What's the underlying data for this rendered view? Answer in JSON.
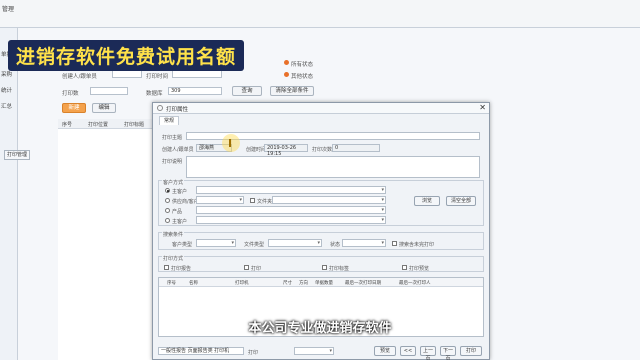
{
  "overlay": {
    "banner_text": "进销存软件免费试用名额",
    "caption_text": "本公司专业做进销存软件"
  },
  "background_app": {
    "menu_label": "管理",
    "nav_items": [
      "单据",
      "采购",
      "统计",
      "汇总"
    ],
    "filter": {
      "row1_label": "创建人/跟单员",
      "row1_field2": "打印时间",
      "radio1": "所有状态",
      "radio2": "其他状态",
      "row2_label": "打印数",
      "row2_field": "数据库",
      "row2_value": "309",
      "query_button": "查询",
      "clear_button": "清除全部条件"
    },
    "toolbar": {
      "new_button": "新建",
      "edit_button": "编辑"
    },
    "grid_columns": [
      "序号",
      "打印位置",
      "打印标题"
    ],
    "side_button": "打印管理"
  },
  "dialog": {
    "title": "打印属性",
    "close_glyph": "✕",
    "tab": "常规",
    "print_title_label": "打印主题",
    "creator_label": "创建人/跟单员",
    "creator_value": "邵海燕",
    "time_label": "创建时间",
    "time_value": "2019-03-26 19:15",
    "print_count_label": "打印次数",
    "print_count_value": "0",
    "remark_label": "打印说明",
    "customer_section": "客户方式",
    "radio_main": "主客户",
    "radio_supplier": "供应商/客户",
    "radio_product": "产品",
    "radio_client": "主客户",
    "file_label": "文件夹",
    "btn_browse": "浏览",
    "btn_clear": "清空全部",
    "cond_section": "搜索条件",
    "cond_customer": "客户类型",
    "cond_file": "文件类型",
    "cond_status": "状态",
    "cond_check": "搜索含未完打印",
    "print_section": "打印方式",
    "opt_ship": "打印报告",
    "opt_ship2": "打印",
    "opt_label": "打印标签",
    "opt_preview": "打印预览",
    "list_columns": [
      "序号",
      "名称",
      "打印机",
      "尺寸",
      "方向",
      "单据数量",
      "最后一次打印日期",
      "最后一次打印人"
    ],
    "footer_select": "一般性报告 页面报告类 打印机",
    "footer_print": "打印",
    "footer_buttons": [
      "预览",
      "<<",
      "上一页",
      "下一页",
      "打印"
    ]
  }
}
